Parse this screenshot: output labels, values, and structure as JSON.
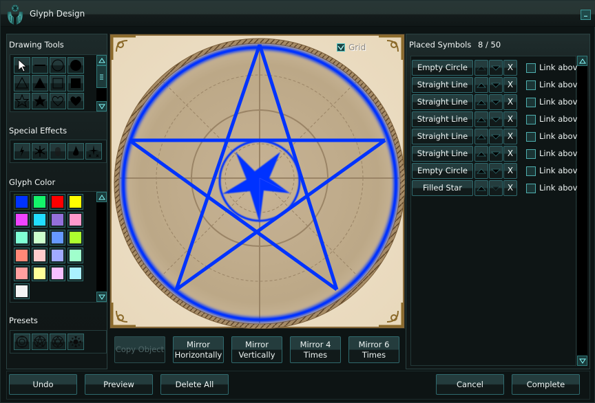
{
  "window": {
    "title": "Glyph Design",
    "icon": "hands-gem-emblem-icon",
    "minimize_label": "_"
  },
  "left_panel": {
    "drawing_tools": {
      "title": "Drawing Tools",
      "tools": [
        {
          "name": "Select",
          "icon": "arrow-cursor-icon"
        },
        {
          "name": "Straight Line",
          "icon": "line-icon"
        },
        {
          "name": "Empty Circle",
          "icon": "empty-circle-icon"
        },
        {
          "name": "Filled Circle",
          "icon": "filled-circle-icon"
        },
        {
          "name": "Empty Triangle",
          "icon": "empty-triangle-icon"
        },
        {
          "name": "Filled Triangle",
          "icon": "filled-triangle-icon"
        },
        {
          "name": "Empty Square",
          "icon": "empty-square-icon"
        },
        {
          "name": "Filled Square",
          "icon": "filled-square-icon"
        },
        {
          "name": "Empty Star",
          "icon": "empty-star-icon"
        },
        {
          "name": "Filled Star",
          "icon": "filled-star-icon"
        },
        {
          "name": "Empty Heart",
          "icon": "empty-heart-icon"
        },
        {
          "name": "Filled Heart",
          "icon": "filled-heart-icon"
        }
      ]
    },
    "special_effects": {
      "title": "Special Effects",
      "effects": [
        {
          "name": "Lightning",
          "icon": "lightning-icon"
        },
        {
          "name": "Snowflake",
          "icon": "snowflake-icon"
        },
        {
          "name": "Glow",
          "icon": "glow-icon"
        },
        {
          "name": "Flame",
          "icon": "flame-icon"
        },
        {
          "name": "Sparkle",
          "icon": "sparkle-icon"
        }
      ]
    },
    "glyph_color": {
      "title": "Glyph Color",
      "selected_index": 0,
      "colors": [
        "#0033ff",
        "#14f46a",
        "#ff0000",
        "#ffff00",
        "#ee44ff",
        "#22ddff",
        "#9370db",
        "#ff99cc",
        "#7fffd4",
        "#ccffcc",
        "#6699ff",
        "#adff2f",
        "#ff8877",
        "#ffcccc",
        "#a0aaff",
        "#a0ffcc",
        "#ff9f9f",
        "#ffff99",
        "#f7bfff",
        "#aaf0ff",
        "#f4f4f4"
      ]
    },
    "presets": {
      "title": "Presets",
      "items": [
        {
          "name": "Preset 1",
          "icon": "preset-octagon-icon"
        },
        {
          "name": "Preset 2",
          "icon": "preset-pentagram-icon"
        },
        {
          "name": "Preset 3",
          "icon": "preset-hexagram-icon"
        },
        {
          "name": "Preset 4",
          "icon": "preset-triangles-icon"
        }
      ]
    }
  },
  "canvas": {
    "grid_label": "Grid",
    "grid_checked": true,
    "glyph_color": "#0033ff"
  },
  "actions": {
    "copy_object": "Copy Object",
    "mirror_h_line1": "Mirror",
    "mirror_h_line2": "Horizontally",
    "mirror_v_line1": "Mirror",
    "mirror_v_line2": "Vertically",
    "mirror4_line1": "Mirror 4",
    "mirror4_line2": "Times",
    "mirror6_line1": "Mirror 6",
    "mirror6_line2": "Times"
  },
  "right_panel": {
    "title": "Placed Symbols",
    "count": "8 / 50",
    "delete_label": "X",
    "link_label": "Link above",
    "symbols": [
      {
        "name": "Empty Circle",
        "link_above": false
      },
      {
        "name": "Straight Line",
        "link_above": false
      },
      {
        "name": "Straight Line",
        "link_above": false
      },
      {
        "name": "Straight Line",
        "link_above": false
      },
      {
        "name": "Straight Line",
        "link_above": false
      },
      {
        "name": "Straight Line",
        "link_above": false
      },
      {
        "name": "Empty Circle",
        "link_above": false
      },
      {
        "name": "Filled Star",
        "link_above": false
      }
    ]
  },
  "bottom": {
    "undo": "Undo",
    "preview": "Preview",
    "delete_all": "Delete All",
    "cancel": "Cancel",
    "complete": "Complete"
  }
}
